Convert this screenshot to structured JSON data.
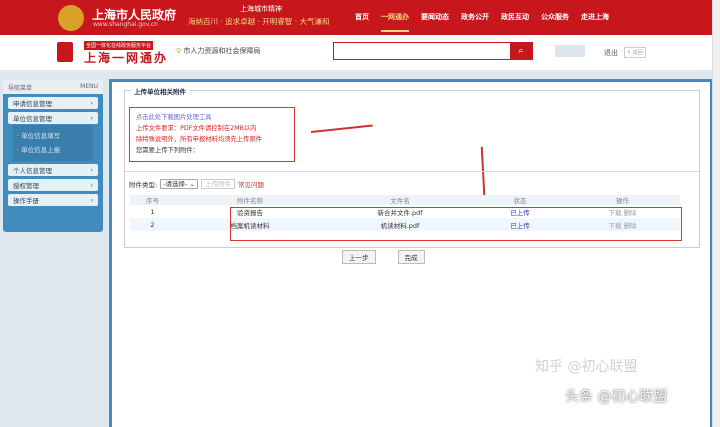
{
  "header": {
    "gov_title": "上海市人民政府",
    "gov_url": "www.shanghai.gov.cn",
    "slogan_title": "上海城市精神",
    "slogan": "海纳百川 · 追求卓越 · 开明睿智 · 大气谦和",
    "nav": [
      "首页",
      "一网通办",
      "要闻动态",
      "政务公开",
      "政民互动",
      "公众服务",
      "走进上海"
    ],
    "active_nav": 1
  },
  "subheader": {
    "platform": "全国一体化在线政务服务平台",
    "brand": "上海一网通办",
    "location": "市人力资源和社会保障局",
    "search_placeholder": "",
    "logout": "退出",
    "back": "返回"
  },
  "sidebar": {
    "title": "导航菜单",
    "title_en": "MENU",
    "items": [
      "申请信息管理",
      "单位信息管理",
      "个人信息管理",
      "授权管理",
      "操作手册"
    ],
    "subitems": [
      "· 单位信息填写",
      "· 单位信息上报"
    ]
  },
  "main": {
    "legend": "上传单位相关附件",
    "notes": {
      "link": "点击此处下载图片处理工具",
      "req1": "上传文件要求：PDF文件请控制在2MB以内",
      "req2": "除特殊说明外，所有申报材料均须先上传原件",
      "need": "您需要上传下列附件："
    },
    "type_label": "附件类型:",
    "type_select": "-请选择-",
    "upload_btn": "上传附件",
    "faq": "常见问题",
    "columns": [
      "序号",
      "附件名称",
      "文件名",
      "状态",
      "操作"
    ],
    "rows": [
      {
        "no": "1",
        "name": "验资报告",
        "file": "新合并文件.pdf",
        "status": "已上传",
        "download": "下载",
        "delete": "删除"
      },
      {
        "no": "2",
        "name": "档案机读材料",
        "file": "机读材料.pdf",
        "status": "已上传",
        "download": "下载",
        "delete": "删除"
      }
    ],
    "prev": "上一步",
    "finish": "完成"
  },
  "watermarks": {
    "zhihu": "知乎 @初心联盟",
    "toutiao": "头条 @初心联盟"
  }
}
